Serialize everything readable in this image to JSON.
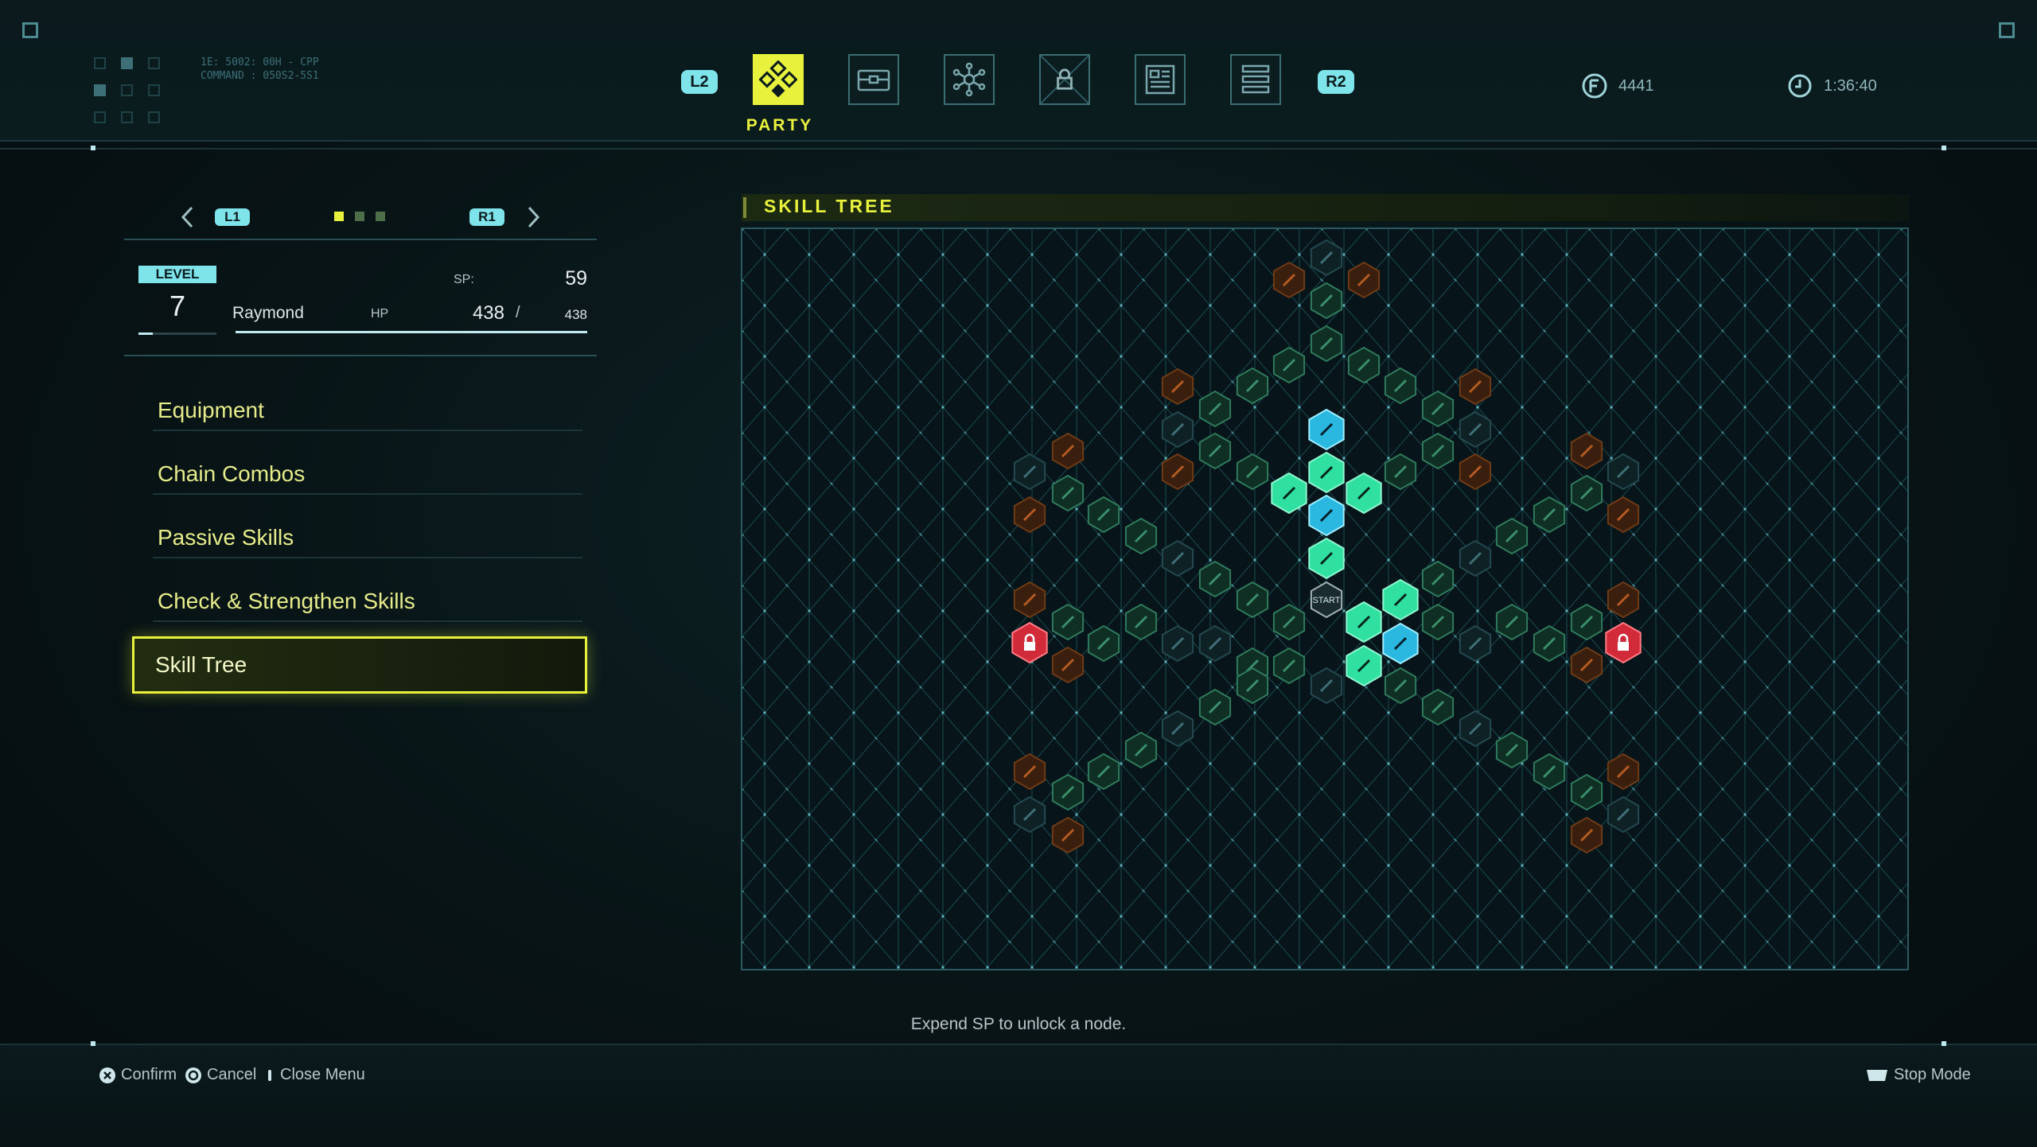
{
  "header": {
    "debug_text": [
      "1E: 5002: 00H - CPP",
      "COMMAND : 050S2-5S1"
    ],
    "tab_keys": {
      "left": "L2",
      "right": "R2"
    },
    "tabs": [
      {
        "name": "party",
        "label": "PARTY",
        "active": true,
        "icon": "party-icon"
      },
      {
        "name": "items",
        "icon": "briefcase-icon"
      },
      {
        "name": "system",
        "icon": "network-icon"
      },
      {
        "name": "locked",
        "icon": "lock-icon"
      },
      {
        "name": "archive",
        "icon": "document-icon"
      },
      {
        "name": "settings",
        "icon": "sliders-icon"
      }
    ],
    "currency": {
      "icon": "credits-icon",
      "value": "4441"
    },
    "playtime": {
      "icon": "clock-icon",
      "value": "1:36:40"
    }
  },
  "character": {
    "nav_left_key": "L1",
    "nav_right_key": "R1",
    "level_label": "LEVEL",
    "level": "7",
    "name": "Raymond",
    "sp_label": "SP:",
    "sp": "59",
    "hp_label": "HP",
    "hp_current": "438",
    "hp_sep": "/",
    "hp_max": "438",
    "hp_fraction": 1.0,
    "exp_fraction": 0.18
  },
  "menu": {
    "items": [
      "Equipment",
      "Chain Combos",
      "Passive Skills",
      "Check & Strengthen Skills",
      "Skill Tree"
    ],
    "selected_index": 4
  },
  "skill_tree": {
    "title": "SKILL TREE",
    "start_label": "START",
    "hint": "Expend SP to unlock a node."
  },
  "footer": {
    "confirm": {
      "icon": "cross-button-icon",
      "label": "Confirm"
    },
    "cancel": {
      "icon": "circle-button-icon",
      "label": "Cancel"
    },
    "close": {
      "icon": "options-button-icon",
      "label": "Close Menu"
    },
    "stop": {
      "icon": "touchpad-icon",
      "label": "Stop Mode"
    }
  },
  "colors": {
    "accent_yellow": "#e8f23c",
    "cyan": "#7fe3ea",
    "unlocked_green": "#2fe0a0",
    "locked_node": "#d12b3a",
    "orange_node": "#8a4a1e"
  }
}
